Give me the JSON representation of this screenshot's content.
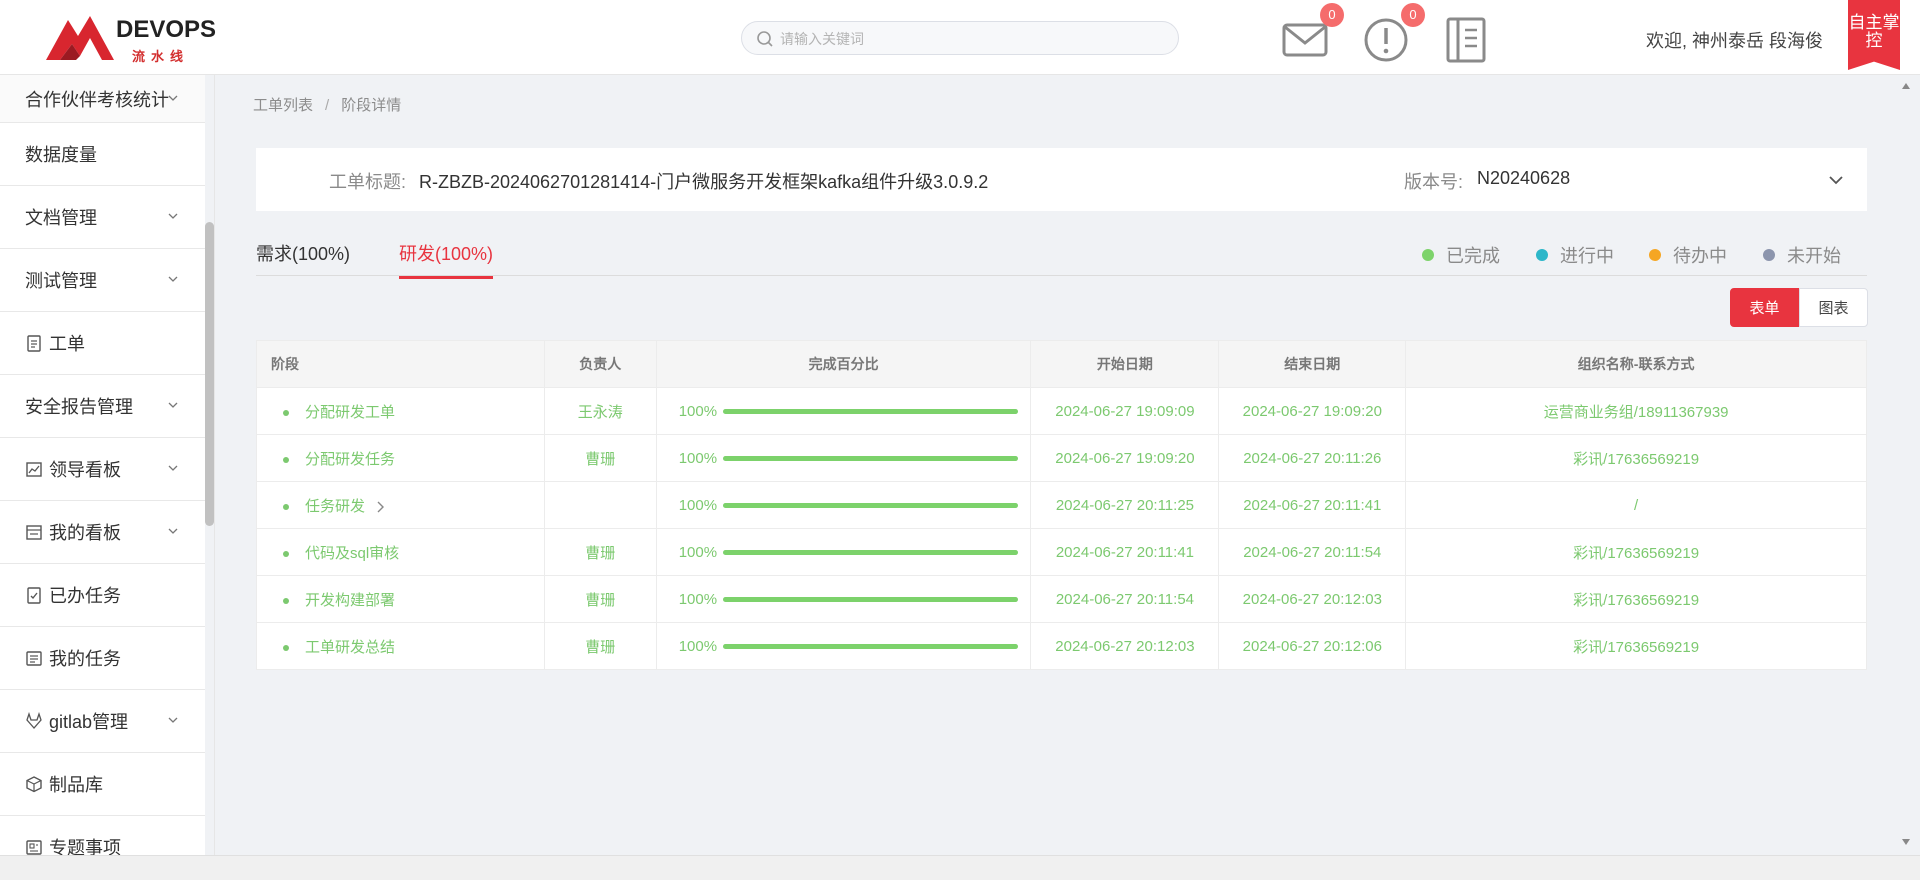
{
  "header": {
    "logo_text": "DEVOPS",
    "logo_sub": "流水线",
    "search_placeholder": "请输入关键词",
    "mail_count": "0",
    "alert_count": "0",
    "welcome": "欢迎, 神州泰岳 段海俊",
    "corner_label": "自主掌控"
  },
  "sidebar": {
    "items": [
      {
        "label": "合作伙伴考核统计",
        "icon": "",
        "chevron": true
      },
      {
        "label": "数据度量",
        "icon": "",
        "chevron": false
      },
      {
        "label": "文档管理",
        "icon": "",
        "chevron": true
      },
      {
        "label": "测试管理",
        "icon": "",
        "chevron": true
      },
      {
        "label": "工单",
        "icon": "clipboard-icon",
        "chevron": false
      },
      {
        "label": "安全报告管理",
        "icon": "",
        "chevron": true
      },
      {
        "label": "领导看板",
        "icon": "chart-icon",
        "chevron": true
      },
      {
        "label": "我的看板",
        "icon": "board-icon",
        "chevron": true
      },
      {
        "label": "已办任务",
        "icon": "check-clipboard-icon",
        "chevron": false
      },
      {
        "label": "我的任务",
        "icon": "list-icon",
        "chevron": false
      },
      {
        "label": "gitlab管理",
        "icon": "gitlab-icon",
        "chevron": true
      },
      {
        "label": "制品库",
        "icon": "box-icon",
        "chevron": false
      },
      {
        "label": "专题事项",
        "icon": "doc-icon",
        "chevron": false
      }
    ]
  },
  "breadcrumb": {
    "parent": "工单列表",
    "separator": "/",
    "current": "阶段详情"
  },
  "info": {
    "title_label": "工单标题:",
    "title_value": "R-ZBZB-2024062701281414-门户微服务开发框架kafka组件升级3.0.9.2",
    "version_label": "版本号:",
    "version_value": "N20240628"
  },
  "tabs": [
    {
      "label": "需求(100%)",
      "active": false
    },
    {
      "label": "研发(100%)",
      "active": true
    }
  ],
  "legend": [
    {
      "label": "已完成",
      "color": "#7dd36b"
    },
    {
      "label": "进行中",
      "color": "#2db7c9"
    },
    {
      "label": "待办中",
      "color": "#f5a623"
    },
    {
      "label": "未开始",
      "color": "#8c95ad"
    }
  ],
  "view_buttons": {
    "form": "表单",
    "chart": "图表"
  },
  "table": {
    "headers": [
      "阶段",
      "负责人",
      "完成百分比",
      "开始日期",
      "结束日期",
      "组织名称-联系方式"
    ],
    "rows": [
      {
        "stage": "分配研发工单",
        "owner": "王永涛",
        "percent": "100%",
        "progress": 1.0,
        "start": "2024-06-27 19:09:09",
        "end": "2024-06-27 19:09:20",
        "org": "运营商业务组/18911367939",
        "expandable": false
      },
      {
        "stage": "分配研发任务",
        "owner": "曹珊",
        "percent": "100%",
        "progress": 1.0,
        "start": "2024-06-27 19:09:20",
        "end": "2024-06-27 20:11:26",
        "org": "彩讯/17636569219",
        "expandable": false
      },
      {
        "stage": "任务研发",
        "owner": "",
        "percent": "100%",
        "progress": 1.0,
        "start": "2024-06-27 20:11:25",
        "end": "2024-06-27 20:11:41",
        "org": "/",
        "expandable": true
      },
      {
        "stage": "代码及sql审核",
        "owner": "曹珊",
        "percent": "100%",
        "progress": 1.0,
        "start": "2024-06-27 20:11:41",
        "end": "2024-06-27 20:11:54",
        "org": "彩讯/17636569219",
        "expandable": false
      },
      {
        "stage": "开发构建部署",
        "owner": "曹珊",
        "percent": "100%",
        "progress": 1.0,
        "start": "2024-06-27 20:11:54",
        "end": "2024-06-27 20:12:03",
        "org": "彩讯/17636569219",
        "expandable": false
      },
      {
        "stage": "工单研发总结",
        "owner": "曹珊",
        "percent": "100%",
        "progress": 1.0,
        "start": "2024-06-27 20:12:03",
        "end": "2024-06-27 20:12:06",
        "org": "彩讯/17636569219",
        "expandable": false
      }
    ]
  }
}
